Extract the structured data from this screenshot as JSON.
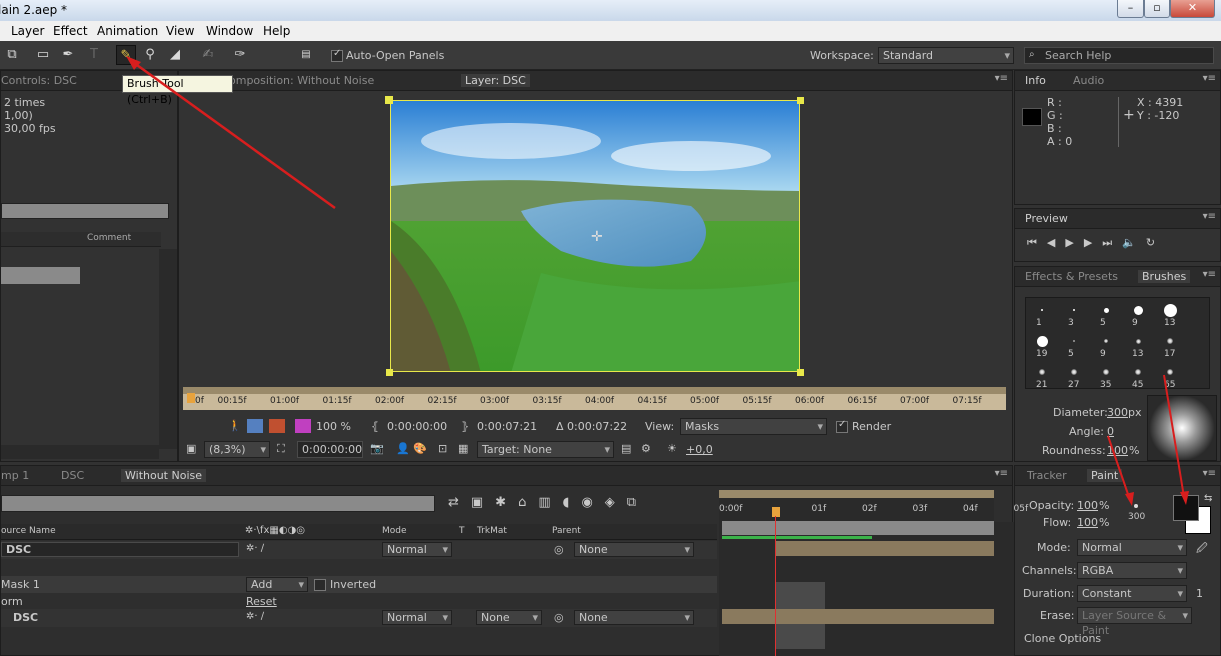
{
  "window": {
    "title": "lain 2.aep *",
    "minimize": "–",
    "maximize": "▫",
    "close": "✕"
  },
  "menu": [
    "Layer",
    "Effect",
    "Animation",
    "View",
    "Window",
    "Help"
  ],
  "toolbar": {
    "auto_open_panels": "Auto-Open Panels",
    "tooltip": "Brush Tool (Ctrl+B)",
    "workspace_label": "Workspace:",
    "workspace_value": "Standard",
    "search_placeholder": "Search Help"
  },
  "effect_controls": {
    "tab": "Controls: DSC",
    "lines": [
      "2 times",
      "1,00)",
      "30,00 fps"
    ],
    "comment_header": "Comment"
  },
  "viewer": {
    "tab_composition": "omposition: Without Noise",
    "tab_layer": "Layer: DSC",
    "ruler_ticks": [
      "0f",
      "00:15f",
      "01:00f",
      "01:15f",
      "02:00f",
      "02:15f",
      "03:00f",
      "03:15f",
      "04:00f",
      "04:15f",
      "05:00f",
      "05:15f",
      "06:00f",
      "06:15f",
      "07:00f",
      "07:15f"
    ],
    "time_in": "0:00:00:00",
    "time_out": "0:00:07:21",
    "duration": "Δ 0:00:07:22",
    "view_label": "View:",
    "view_value": "Masks",
    "render_label": "Render",
    "zoom": "(8,3%)",
    "current_time": "0:00:00:00",
    "target": "Target: None",
    "offset": "+0,0",
    "opacity_pct": "100 %"
  },
  "info": {
    "tab_info": "Info",
    "tab_audio": "Audio",
    "r": "R :",
    "g": "G :",
    "b": "B :",
    "a": "A : 0",
    "x": "X : 4391",
    "y": "Y : -120"
  },
  "preview": {
    "tab": "Preview"
  },
  "brushes": {
    "tab_effects": "Effects & Presets",
    "tab_brushes": "Brushes",
    "sizes": [
      "1",
      "3",
      "5",
      "9",
      "13",
      "19",
      "5",
      "9",
      "13",
      "17",
      "21",
      "27",
      "35",
      "45",
      "65"
    ],
    "diameter_label": "Diameter:",
    "diameter_value": "300",
    "diameter_unit": "px",
    "angle_label": "Angle:",
    "angle_value": "0",
    "roundness_label": "Roundness:",
    "roundness_value": "100",
    "roundness_unit": "%"
  },
  "paint": {
    "tab_tracker": "Tracker",
    "tab_paint": "Paint",
    "opacity_label": "Opacity:",
    "opacity_value": "100",
    "flow_label": "Flow:",
    "flow_value": "100",
    "pct": "%",
    "brush_size": "300",
    "mode_label": "Mode:",
    "mode_value": "Normal",
    "channels_label": "Channels:",
    "channels_value": "RGBA",
    "duration_label": "Duration:",
    "duration_value": "Constant",
    "duration_frames": "1",
    "erase_label": "Erase:",
    "erase_value": "Layer Source & Paint",
    "clone_options": "Clone Options",
    "fg_color": "#111111",
    "bg_color": "#ffffff"
  },
  "timeline": {
    "tabs": [
      "mp 1",
      "DSC",
      "Without Noise"
    ],
    "col_source": "ource Name",
    "col_mode": "Mode",
    "col_t": "T",
    "col_trkmat": "TrkMat",
    "col_parent": "Parent",
    "time_ticks": [
      "0:00f",
      "01f",
      "02f",
      "03f",
      "04f",
      "05f"
    ],
    "rows": [
      {
        "name": "DSC",
        "mode": "Normal",
        "parent": "None"
      },
      {
        "name": "Mask 1",
        "add": "Add",
        "inverted": "Inverted"
      },
      {
        "name": "orm",
        "reset": "Reset"
      },
      {
        "name": "DSC",
        "mode": "Normal",
        "trkmat": "None",
        "parent": "None"
      }
    ]
  }
}
